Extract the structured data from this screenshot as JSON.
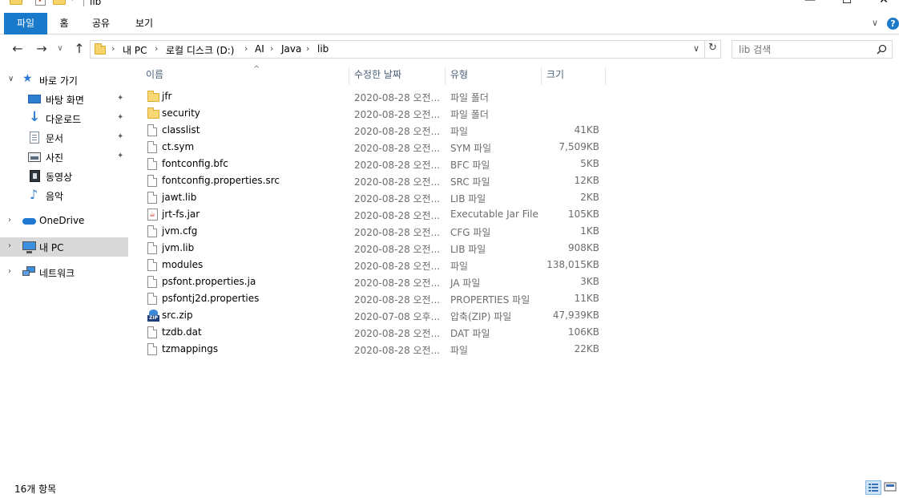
{
  "window": {
    "title": "lib",
    "minimize": "—",
    "maximize": "☐",
    "close": "✕"
  },
  "ribbon": {
    "tabs": [
      {
        "label": "파일",
        "active": true
      },
      {
        "label": "홈"
      },
      {
        "label": "공유"
      },
      {
        "label": "보기"
      }
    ],
    "expand_chevron": "∨",
    "help": "?"
  },
  "nav": {
    "back": "←",
    "forward": "→",
    "recent": "∨",
    "up": "↑",
    "address": {
      "crumbs": [
        "내 PC",
        "로컬 디스크 (D:)",
        "AI",
        "Java",
        "lib"
      ],
      "separator": "›",
      "dropdown": "∨",
      "refresh": "↻"
    },
    "search": {
      "placeholder": "lib 검색",
      "icon": "search-icon"
    }
  },
  "sidebar": {
    "items": [
      {
        "label": "바로 가기",
        "icon": "star-icon",
        "chevron": "∨",
        "level": 0
      },
      {
        "label": "바탕 화면",
        "icon": "desktop-icon",
        "pinned": true,
        "level": 1
      },
      {
        "label": "다운로드",
        "icon": "download-icon",
        "pinned": true,
        "level": 1
      },
      {
        "label": "문서",
        "icon": "document-icon",
        "pinned": true,
        "level": 1
      },
      {
        "label": "사진",
        "icon": "picture-icon",
        "pinned": true,
        "level": 1
      },
      {
        "label": "동영상",
        "icon": "video-icon",
        "level": 1
      },
      {
        "label": "음악",
        "icon": "music-icon",
        "level": 1
      },
      {
        "label": "OneDrive",
        "icon": "cloud-icon",
        "chevron": "›",
        "level": 0
      },
      {
        "label": "내 PC",
        "icon": "computer-icon",
        "chevron": "›",
        "level": 0,
        "selected": true
      },
      {
        "label": "네트워크",
        "icon": "network-icon",
        "chevron": "›",
        "level": 0
      }
    ],
    "pin_glyph": "📌"
  },
  "columns": {
    "name": "이름",
    "date": "수정한 날짜",
    "type": "유형",
    "size": "크기",
    "sort_indicator": "^"
  },
  "files": [
    {
      "name": "jfr",
      "date": "2020-08-28 오전...",
      "type": "파일 폴더",
      "size": "",
      "kind": "folder"
    },
    {
      "name": "security",
      "date": "2020-08-28 오전...",
      "type": "파일 폴더",
      "size": "",
      "kind": "folder"
    },
    {
      "name": "classlist",
      "date": "2020-08-28 오전...",
      "type": "파일",
      "size": "41KB",
      "kind": "file"
    },
    {
      "name": "ct.sym",
      "date": "2020-08-28 오전...",
      "type": "SYM 파일",
      "size": "7,509KB",
      "kind": "file"
    },
    {
      "name": "fontconfig.bfc",
      "date": "2020-08-28 오전...",
      "type": "BFC 파일",
      "size": "5KB",
      "kind": "file"
    },
    {
      "name": "fontconfig.properties.src",
      "date": "2020-08-28 오전...",
      "type": "SRC 파일",
      "size": "12KB",
      "kind": "file"
    },
    {
      "name": "jawt.lib",
      "date": "2020-08-28 오전...",
      "type": "LIB 파일",
      "size": "2KB",
      "kind": "file"
    },
    {
      "name": "jrt-fs.jar",
      "date": "2020-08-28 오전...",
      "type": "Executable Jar File",
      "size": "105KB",
      "kind": "jar"
    },
    {
      "name": "jvm.cfg",
      "date": "2020-08-28 오전...",
      "type": "CFG 파일",
      "size": "1KB",
      "kind": "file"
    },
    {
      "name": "jvm.lib",
      "date": "2020-08-28 오전...",
      "type": "LIB 파일",
      "size": "908KB",
      "kind": "file"
    },
    {
      "name": "modules",
      "date": "2020-08-28 오전...",
      "type": "파일",
      "size": "138,015KB",
      "kind": "file"
    },
    {
      "name": "psfont.properties.ja",
      "date": "2020-08-28 오전...",
      "type": "JA 파일",
      "size": "3KB",
      "kind": "file"
    },
    {
      "name": "psfontj2d.properties",
      "date": "2020-08-28 오전...",
      "type": "PROPERTIES 파일",
      "size": "11KB",
      "kind": "file"
    },
    {
      "name": "src.zip",
      "date": "2020-07-08 오후...",
      "type": "압축(ZIP) 파일",
      "size": "47,939KB",
      "kind": "zip"
    },
    {
      "name": "tzdb.dat",
      "date": "2020-08-28 오전...",
      "type": "DAT 파일",
      "size": "106KB",
      "kind": "file"
    },
    {
      "name": "tzmappings",
      "date": "2020-08-28 오전...",
      "type": "파일",
      "size": "22KB",
      "kind": "file"
    }
  ],
  "status": {
    "item_count": "16개 항목"
  },
  "colors": {
    "accent": "#1979ca",
    "folder": "#f8d775",
    "selected_nav": "#d9d9d9",
    "header_text": "#4c607a"
  }
}
